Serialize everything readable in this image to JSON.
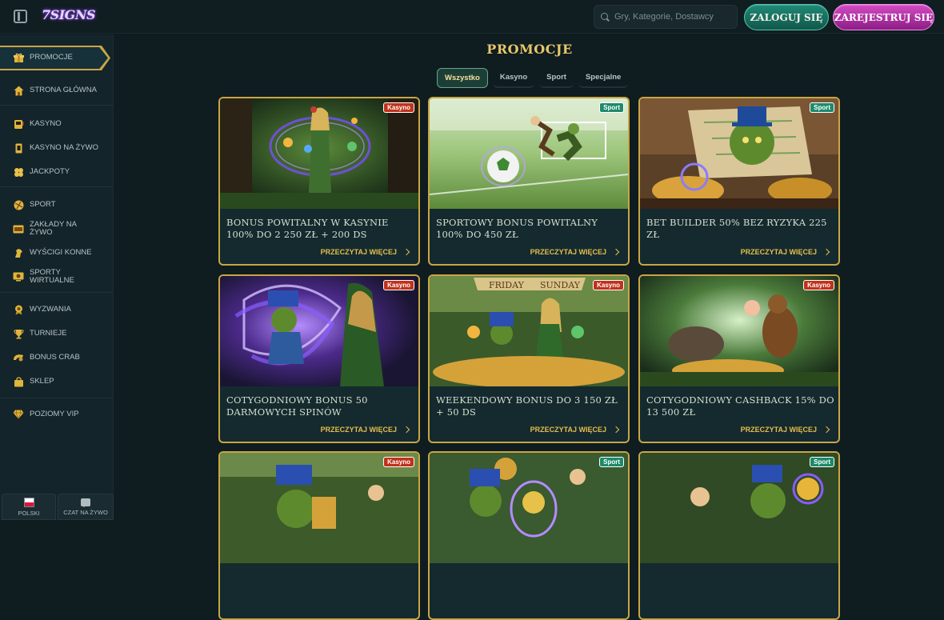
{
  "header": {
    "logo_text": "7SIGNS",
    "search_placeholder": "Gry, Kategorie, Dostawcy",
    "login_label": "ZALOGUJ SIĘ",
    "register_label": "ZAREJESTRUJ SIĘ"
  },
  "sidebar": {
    "items": [
      {
        "label": "PROMOCJE",
        "icon": "gift-icon",
        "active": true
      },
      {
        "label": "STRONA GŁÓWNA",
        "icon": "home-icon"
      },
      {
        "label": "KASYNO",
        "icon": "slot-machine-icon"
      },
      {
        "label": "KASYNO NA ŻYWO",
        "icon": "cards-icon"
      },
      {
        "label": "JACKPOTY",
        "icon": "clover-icon"
      },
      {
        "label": "SPORT",
        "icon": "ball-icon"
      },
      {
        "label": "ZAKŁADY NA ŻYWO",
        "icon": "live-betting-icon"
      },
      {
        "label": "WYŚCIGI KONNE",
        "icon": "horse-icon"
      },
      {
        "label": "SPORTY WIRTUALNE",
        "icon": "virtual-sport-icon"
      },
      {
        "label": "WYZWANIA",
        "icon": "medal-icon"
      },
      {
        "label": "TURNIEJE",
        "icon": "trophy-icon"
      },
      {
        "label": "BONUS CRAB",
        "icon": "crab-icon"
      },
      {
        "label": "SKLEP",
        "icon": "shop-bag-icon"
      },
      {
        "label": "POZIOMY VIP",
        "icon": "diamond-icon"
      }
    ],
    "language_label": "POLSKI",
    "chat_label": "CZAT NA ŻYWO"
  },
  "main": {
    "title": "PROMOCJE",
    "tabs": [
      "Wszystko",
      "Kasyno",
      "Sport",
      "Specjalne"
    ],
    "read_more": "PRZECZYTAJ WIĘCEJ",
    "cards": [
      {
        "badge": "Kasyno",
        "title": "BONUS POWITALNY W KASYNIE 100% DO 2 250 ZŁ + 200 DS"
      },
      {
        "badge": "Sport",
        "title": "SPORTOWY BONUS POWITALNY 100% DO 450 ZŁ"
      },
      {
        "badge": "Sport",
        "title": "BET BUILDER 50% BEZ RYZYKA 225 ZŁ"
      },
      {
        "badge": "Kasyno",
        "title": "COTYGODNIOWY BONUS 50 DARMOWYCH SPINÓW"
      },
      {
        "badge": "Kasyno",
        "title": "WEEKENDOWY BONUS DO 3 150 ZŁ + 50 DS",
        "image_text": "FRIDAY SUNDAY"
      },
      {
        "badge": "Kasyno",
        "title": "COTYGODNIOWY CASHBACK 15% DO 13 500 ZŁ"
      },
      {
        "badge": "Kasyno",
        "title": ""
      },
      {
        "badge": "Sport",
        "title": ""
      },
      {
        "badge": "Sport",
        "title": ""
      }
    ]
  }
}
